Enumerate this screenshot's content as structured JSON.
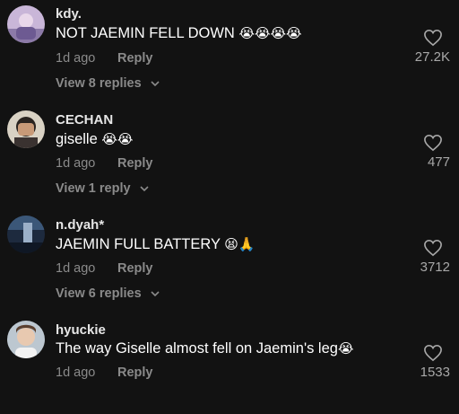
{
  "comments": [
    {
      "username": "kdy.",
      "text": "NOT JAEMIN FELL DOWN",
      "emojis": "😭😭😭😭",
      "time": "1d ago",
      "reply_label": "Reply",
      "view_replies": "View 8 replies",
      "likes": "27.2K",
      "avatar_icon": "avatar-lilac-photo"
    },
    {
      "username": "CECHAN",
      "text": "giselle",
      "emojis": "😭😭",
      "time": "1d ago",
      "reply_label": "Reply",
      "view_replies": "View 1 reply",
      "likes": "477",
      "avatar_icon": "avatar-person-covering-face"
    },
    {
      "username": "n.dyah*",
      "text": "JAEMIN FULL BATTERY",
      "emojis": "😫🙏",
      "time": "1d ago",
      "reply_label": "Reply",
      "view_replies": "View 6 replies",
      "likes": "3712",
      "avatar_icon": "avatar-blue-night-photo"
    },
    {
      "username": "hyuckie",
      "text": "The way Giselle almost fell on Jaemin's leg",
      "emojis": "😭",
      "time": "1d ago",
      "reply_label": "Reply",
      "view_replies": "",
      "likes": "1533",
      "avatar_icon": "avatar-person-portrait"
    }
  ],
  "colors": {
    "background": "#121212",
    "text": "#ffffff",
    "muted": "#8a8a8a"
  }
}
